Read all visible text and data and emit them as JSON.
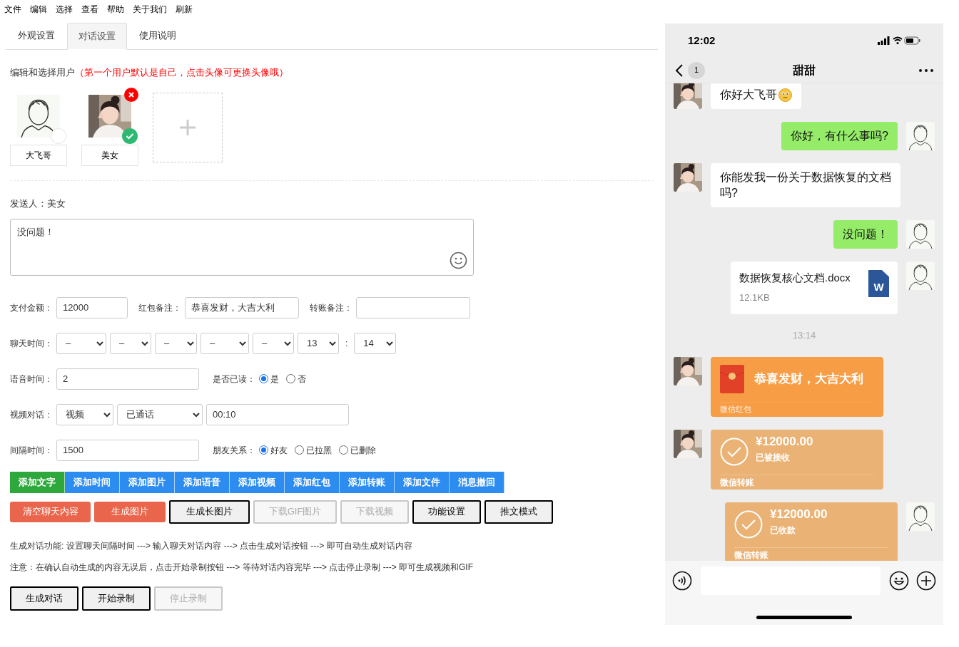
{
  "menu": [
    "文件",
    "编辑",
    "选择",
    "查看",
    "帮助",
    "关于我们",
    "刷新"
  ],
  "tabs": [
    {
      "label": "外观设置",
      "selected": false
    },
    {
      "label": "对话设置",
      "selected": true
    },
    {
      "label": "使用说明",
      "selected": false
    }
  ],
  "users": {
    "heading": "编辑和选择用户",
    "note": "（第一个用户默认是自己，点击头像可更换头像哦）",
    "items": [
      {
        "name": "大飞哥",
        "kind": "sketch",
        "selected": false,
        "deletable": false
      },
      {
        "name": "美女",
        "selected": true,
        "deletable": true
      }
    ]
  },
  "sender": {
    "label": "发送人：",
    "value": "美女"
  },
  "message": {
    "value": "没问题！"
  },
  "form_rows": [
    {
      "label": "支付金额：",
      "items": [
        {
          "kind": "input",
          "value": "12000"
        },
        {
          "kind": "label",
          "text": "红包备注："
        },
        {
          "kind": "input",
          "value": "恭喜发财，大吉大利"
        },
        {
          "kind": "label",
          "text": "转账备注："
        },
        {
          "kind": "input"
        }
      ]
    },
    {
      "label": "聊天时间：",
      "items": [
        {
          "kind": "select",
          "value": "–"
        },
        {
          "kind": "select",
          "value": "–"
        },
        {
          "kind": "select",
          "value": "–"
        },
        {
          "kind": "select",
          "value": "–"
        },
        {
          "kind": "select",
          "value": "–"
        },
        {
          "kind": "select",
          "value": "13"
        },
        {
          "kind": "sep",
          "text": ":"
        },
        {
          "kind": "select",
          "value": "14"
        }
      ]
    },
    {
      "label": "语音时间：",
      "items": [
        {
          "kind": "input",
          "value": "2"
        },
        {
          "kind": "radio",
          "text": "是否已读：",
          "options": [
            {
              "label": "是",
              "selected": true
            },
            {
              "label": "否",
              "selected": false
            }
          ]
        }
      ]
    },
    {
      "label": "视频对话：",
      "items": [
        {
          "kind": "select",
          "value": "视频"
        },
        {
          "kind": "select",
          "value": "已通话"
        },
        {
          "kind": "input",
          "value": "00:10"
        }
      ]
    },
    {
      "label": "间隔时间：",
      "items": [
        {
          "kind": "input",
          "value": "1500"
        },
        {
          "kind": "radio",
          "text": "朋友关系：",
          "options": [
            {
              "label": "好友",
              "selected": true
            },
            {
              "label": "已拉黑",
              "selected": false
            },
            {
              "label": "已删除",
              "selected": false
            }
          ]
        }
      ]
    }
  ],
  "add_buttons": [
    {
      "label": "添加文字",
      "selected": true
    },
    {
      "label": "添加时间",
      "selected": false
    },
    {
      "label": "添加图片",
      "selected": false
    },
    {
      "label": "添加语音",
      "selected": false
    },
    {
      "label": "添加视频",
      "selected": false
    },
    {
      "label": "添加红包",
      "selected": false
    },
    {
      "label": "添加转账",
      "selected": false
    },
    {
      "label": "添加文件",
      "selected": false
    },
    {
      "label": "消息撤回",
      "selected": false
    }
  ],
  "action_buttons": [
    {
      "label": "清空聊天内容",
      "kind": "danger",
      "disabled": false
    },
    {
      "label": "生成图片",
      "kind": "danger",
      "disabled": false
    },
    {
      "label": "生成长图片",
      "kind": "default",
      "disabled": false
    },
    {
      "label": "下载GIF图片",
      "kind": "default",
      "disabled": true
    },
    {
      "label": "下载视频",
      "kind": "default",
      "disabled": true
    },
    {
      "label": "功能设置",
      "kind": "default",
      "disabled": false
    },
    {
      "label": "推文模式",
      "kind": "default",
      "disabled": false
    }
  ],
  "help_lines": [
    "生成对话功能: 设置聊天间隔时间 ---> 输入聊天对话内容 ---> 点击生成对话按钮 ---> 即可自动生成对话内容",
    "注意：在确认自动生成的内容无误后，点击开始录制按钮 ---> 等待对话内容完毕 ---> 点击停止录制 ---> 即可生成视频和GIF"
  ],
  "bottom_buttons": [
    {
      "label": "生成对话",
      "disabled": false
    },
    {
      "label": "开始录制",
      "disabled": false
    },
    {
      "label": "停止录制",
      "disabled": true
    }
  ],
  "phone": {
    "time": "12:02",
    "title": "甜甜",
    "unread": "1",
    "messages": [
      {
        "kind": "text",
        "outgoing": false,
        "text": "你好大飞哥",
        "emoji": true
      },
      {
        "kind": "text",
        "outgoing": true,
        "text": "你好，有什么事吗?",
        "emoji": false
      },
      {
        "kind": "text",
        "outgoing": false,
        "text": "你能发我一份关于数据恢复的文档吗?",
        "emoji": false
      },
      {
        "kind": "text",
        "outgoing": true,
        "text": "没问题！",
        "emoji": false
      },
      {
        "kind": "file",
        "outgoing": true,
        "name": "数据恢复核心文档.docx",
        "size": "12.1KB",
        "badge": "W"
      },
      {
        "kind": "time",
        "text": "13:14"
      },
      {
        "kind": "red_packet",
        "outgoing": false,
        "text": "恭喜发财，大吉大利",
        "footer": "微信红包"
      },
      {
        "kind": "transfer",
        "outgoing": false,
        "amount": "¥12000.00",
        "status": "已被接收",
        "footer": "微信转账"
      },
      {
        "kind": "transfer",
        "outgoing": true,
        "amount": "¥12000.00",
        "status": "已收款",
        "footer": "微信转账"
      }
    ]
  }
}
